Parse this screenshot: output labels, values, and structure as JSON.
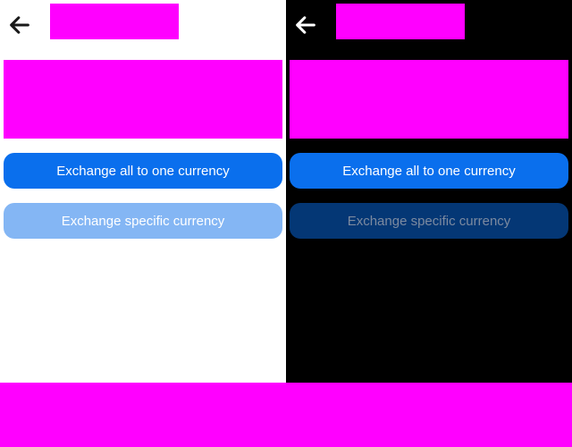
{
  "themes": {
    "light": {
      "background": "#ffffff",
      "back_icon": "arrow-left-icon",
      "back_icon_color": "#1a1a1a",
      "primary_button": {
        "label": "Exchange all to one currency",
        "bg": "#0a6fed",
        "fg": "#ffffff"
      },
      "secondary_button": {
        "label": "Exchange specific currency",
        "bg": "#84b6f4",
        "fg": "#ffffff"
      }
    },
    "dark": {
      "background": "#000000",
      "back_icon": "arrow-left-icon",
      "back_icon_color": "#ffffff",
      "primary_button": {
        "label": "Exchange all to one currency",
        "bg": "#0a6fed",
        "fg": "#ffffff"
      },
      "secondary_button": {
        "label": "Exchange specific currency",
        "bg": "#043775",
        "fg": "#7c8aa0"
      }
    }
  },
  "placeholder_color": "#ff00ff"
}
